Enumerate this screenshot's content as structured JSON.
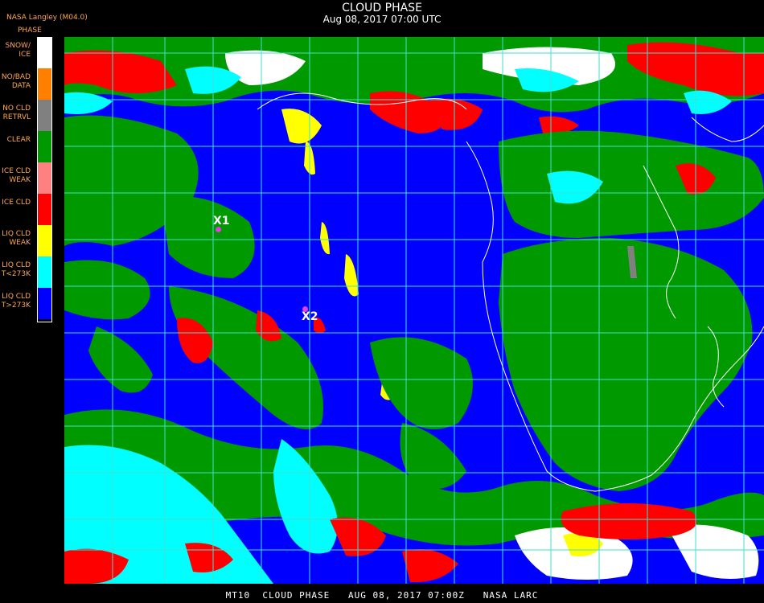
{
  "header": {
    "title": "CLOUD PHASE",
    "subtitle": "Aug 08, 2017 07:00 UTC",
    "agency": "NASA Langley (M04.0)",
    "legend_title": "PHASE"
  },
  "legend": [
    {
      "label": "SNOW/\nICE",
      "color": "#ffffff"
    },
    {
      "label": "NO/BAD\nDATA",
      "color": "#ff8000"
    },
    {
      "label": "NO CLD\nRETRVL",
      "color": "#808080"
    },
    {
      "label": "CLEAR",
      "color": "#009900"
    },
    {
      "label": "ICE CLD\nWEAK",
      "color": "#ff8080"
    },
    {
      "label": "ICE CLD",
      "color": "#ff0000"
    },
    {
      "label": "LIQ CLD\nWEAK",
      "color": "#ffff00"
    },
    {
      "label": "LIQ CLD\nT<273K",
      "color": "#00ffff"
    },
    {
      "label": "LIQ CLD\nT>273K",
      "color": "#0000ff"
    }
  ],
  "markers": [
    {
      "label": "X1"
    },
    {
      "label": "X2"
    }
  ],
  "footer": {
    "text": "MT10  CLOUD PHASE   AUG 08, 2017 07:00Z   NASA LARC"
  }
}
